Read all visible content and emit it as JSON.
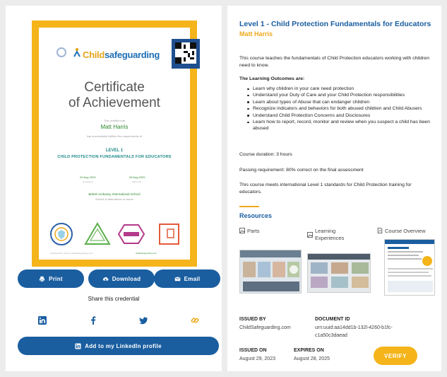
{
  "certificate": {
    "logo_word_1": "Child",
    "logo_word_2": "safeguarding",
    "qr_label": "VERIFY",
    "title_line_1": "Certificate",
    "title_line_2": "of Achievement",
    "awarded_to": "This certifies that",
    "recipient": "Matt Harris",
    "completed_text": "has successfully fulfilled the requirements of",
    "level": "LEVEL 1",
    "course": "CHILD PROTECTION FUNDAMENTALS FOR EDUCATORS",
    "date_1": "29 Aug 2023",
    "date_1_label": "Completed",
    "date_2": "28 Aug 2025",
    "date_2_label": "Valid until",
    "school": "British Ambassy International School",
    "school_sub": "School of attendance or issuer",
    "footer_left": "Certificate ID: verify at childsafeguarding.com",
    "footer_right": "childsafeguarding.com"
  },
  "actions": {
    "print_label": "Print",
    "download_label": "Download",
    "email_label": "Email",
    "share_label": "Share this credential",
    "linkedin_label": "Add to my LinkedIn profile"
  },
  "course": {
    "title": "Level 1 - Child Protection Fundamentals for Educators",
    "learner": "Matt Harris",
    "intro": "This course teaches the fundamentals of Child Protection educators working with children need to know.",
    "outcomes_heading": "The Learning Outcomes are:",
    "outcomes": [
      "Learn why children in your care need protection",
      "Understand your Duty of Care and your Child Protection responsibilities",
      "Learn about types of Abuse that can endanger children",
      "Recognize indicators and behaviors for both abused children and Child Abusers",
      "Understand Child Protection Concerns and Disclosures",
      "Learn how to report, record, monitor and review when you suspect a child has been abused"
    ],
    "duration": "Course duration: 3 hours",
    "passing": "Passing requirement: 80% correct on the final assessment",
    "standard": "This course meets international Level 1 standards for Child Protection training for educators."
  },
  "resources": {
    "heading": "Resources",
    "items": [
      "Parts",
      "Learning Experiences",
      "Course Overview"
    ]
  },
  "meta": {
    "issued_by_label": "ISSUED BY",
    "issued_by": "ChildSafeguarding.com",
    "document_id_label": "DOCUMENT ID",
    "document_id_1": "urn:uuid:aa14dd1b-132l-4260-b1fc-",
    "document_id_2": "c1a50c3daead",
    "issued_on_label": "ISSUED ON",
    "issued_on": "August 29, 2023",
    "expires_on_label": "EXPIRES ON",
    "expires_on": "August 28, 2025",
    "verify_label": "VERIFY"
  },
  "colors": {
    "primary": "#1a5ea0",
    "accent": "#f4b41a",
    "background": "#ececec"
  }
}
